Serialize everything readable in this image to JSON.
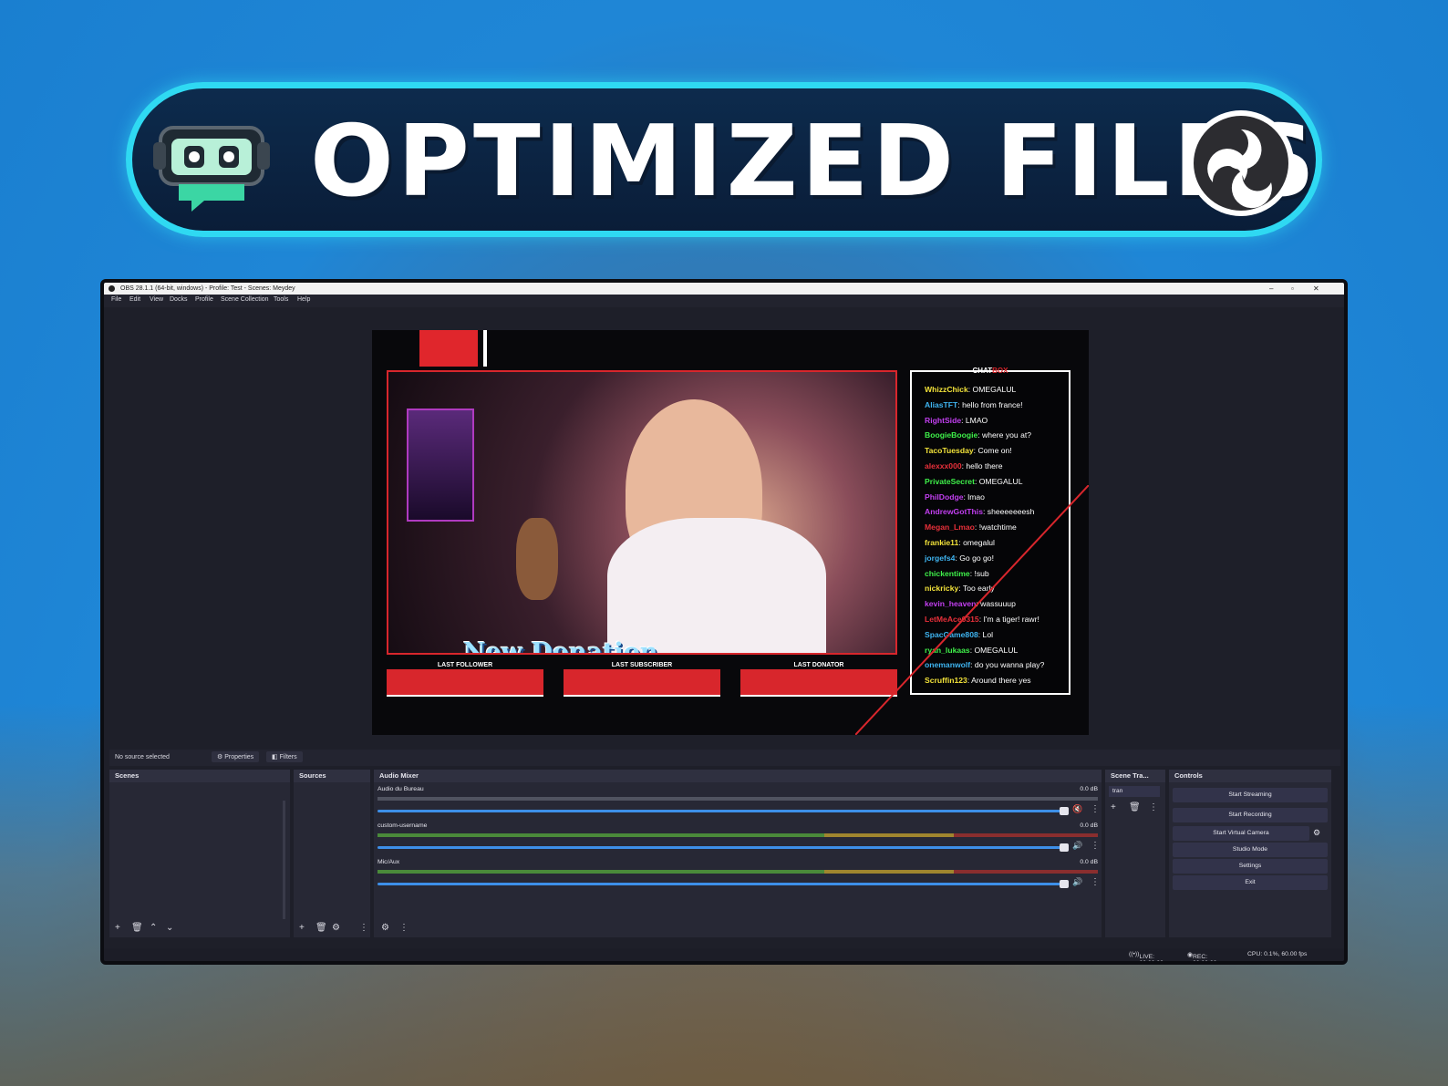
{
  "banner": {
    "title": "OPTIMIZED FILES"
  },
  "window": {
    "title": "OBS 28.1.1 (64-bit, windows) - Profile: Test - Scenes: Meydey",
    "menu": [
      "File",
      "Edit",
      "View",
      "Docks",
      "Profile",
      "Scene Collection",
      "Tools",
      "Help"
    ]
  },
  "overlay": {
    "chat_title_a": "CHAT",
    "chat_title_b": "BOX",
    "donation": "New Donation",
    "bars": [
      "LAST FOLLOWER",
      "LAST SUBSCRIBER",
      "LAST DONATOR"
    ],
    "chat": [
      {
        "user": "WhizzChick",
        "msg": "OMEGALUL",
        "color": "#f2e23a"
      },
      {
        "user": "AliasTFT",
        "msg": "hello from france!",
        "color": "#3fb4f0"
      },
      {
        "user": "RightSide",
        "msg": "LMAO",
        "color": "#c23ff0"
      },
      {
        "user": "BoogieBoogie",
        "msg": "where you at?",
        "color": "#3ff04a"
      },
      {
        "user": "TacoTuesday",
        "msg": "Come on!",
        "color": "#f2e23a"
      },
      {
        "user": "alexxx000",
        "msg": "hello there",
        "color": "#e8303a"
      },
      {
        "user": "PrivateSecret",
        "msg": "OMEGALUL",
        "color": "#3ff04a"
      },
      {
        "user": "PhilDodge",
        "msg": "lmao",
        "color": "#c23ff0"
      },
      {
        "user": "AndrewGotThis",
        "msg": "sheeeeeeesh",
        "color": "#c23ff0"
      },
      {
        "user": "Megan_Lmao",
        "msg": "!watchtime",
        "color": "#e8303a"
      },
      {
        "user": "frankie11",
        "msg": "omegalul",
        "color": "#f2e23a"
      },
      {
        "user": "jorgefs4",
        "msg": "Go go go!",
        "color": "#3fb4f0"
      },
      {
        "user": "chickentime",
        "msg": "!sub",
        "color": "#3ff04a"
      },
      {
        "user": "nickricky",
        "msg": "Too early",
        "color": "#f2e23a"
      },
      {
        "user": "kevin_heaven",
        "msg": "wassuuup",
        "color": "#c23ff0"
      },
      {
        "user": "LetMeAce0315",
        "msg": "I'm a tiger! rawr!",
        "color": "#e8303a"
      },
      {
        "user": "SpacGame808",
        "msg": "Lol",
        "color": "#3fb4f0"
      },
      {
        "user": "ryan_lukaas",
        "msg": "OMEGALUL",
        "color": "#3ff04a"
      },
      {
        "user": "onemanwolf",
        "msg": "do you wanna play?",
        "color": "#3fb4f0"
      },
      {
        "user": "Scruffin123",
        "msg": "Around there yes",
        "color": "#f2e23a"
      }
    ]
  },
  "source_bar": {
    "status": "No source selected",
    "properties": "Properties",
    "filters": "Filters"
  },
  "docks": {
    "scenes": "Scenes",
    "sources": "Sources",
    "audio_mixer": "Audio Mixer",
    "scene_transitions": "Scene Tra...",
    "controls": "Controls",
    "transition_value": "tran"
  },
  "mixer": [
    {
      "name": "Audio du Bureau",
      "db": "0.0 dB",
      "muted": true
    },
    {
      "name": "custom-username",
      "db": "0.0 dB",
      "muted": false
    },
    {
      "name": "Mic/Aux",
      "db": "0.0 dB",
      "muted": false
    }
  ],
  "controls": [
    "Start Streaming",
    "Start Recording",
    "Start Virtual Camera",
    "Studio Mode",
    "Settings",
    "Exit"
  ],
  "status": {
    "live": "LIVE: 00:00:00",
    "rec": "REC: 00:00:00",
    "cpu": "CPU: 0.1%, 60.00 fps"
  }
}
